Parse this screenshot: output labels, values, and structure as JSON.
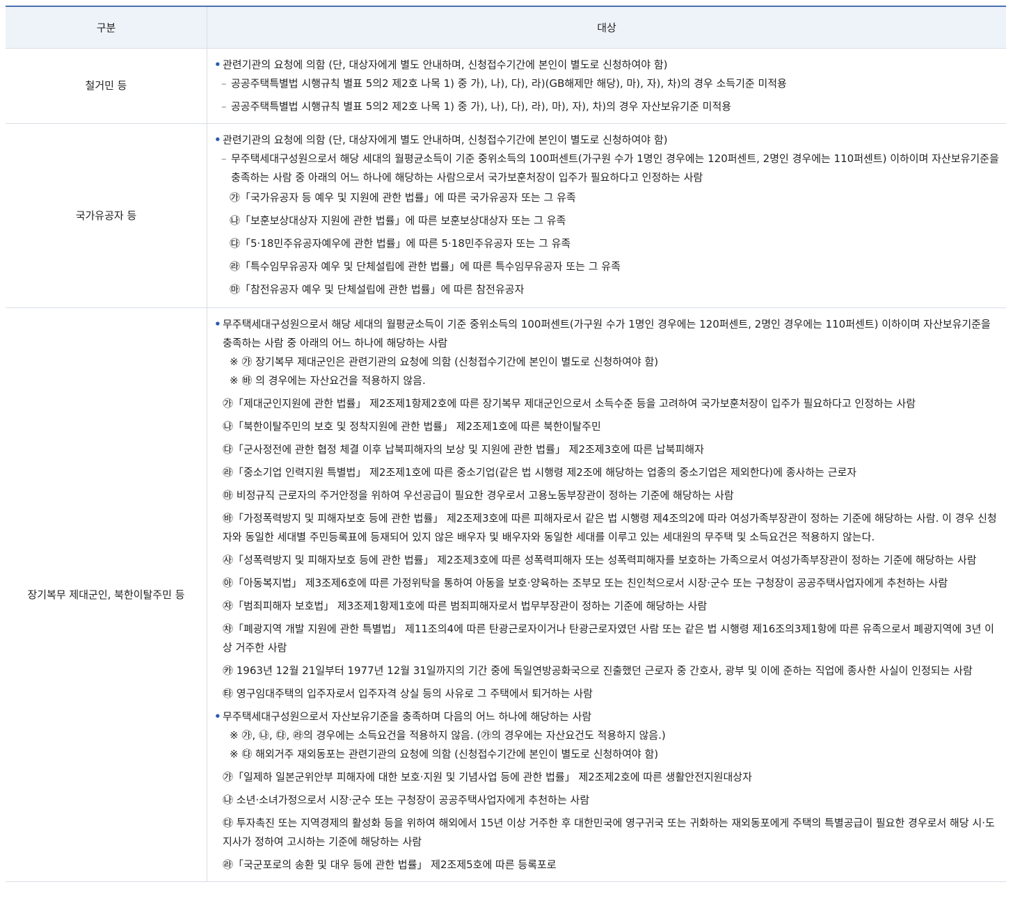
{
  "header": {
    "col1": "구분",
    "col2": "대상"
  },
  "rows": [
    {
      "category": "철거민 등",
      "bullet": "관련기관의 요청에 의함 (단, 대상자에게 별도 안내하며, 신청접수기간에 본인이 별도로 신청하여야 함)",
      "dashes": [
        "공공주택특별법 시행규칙 별표 5의2 제2호 나목 1) 중 가), 나), 다), 라)(GB해제만 해당), 마), 자), 차)의 경우 소득기준 미적용",
        "공공주택특별법 시행규칙 별표 5의2 제2호 나목 1) 중 가), 나), 다), 라), 마), 자), 차)의 경우 자산보유기준 미적용"
      ]
    },
    {
      "category": "국가유공자 등",
      "bullet": "관련기관의 요청에 의함 (단, 대상자에게 별도 안내하며, 신청접수기간에 본인이 별도로 신청하여야 함)",
      "dash": "무주택세대구성원으로서 해당 세대의 월평균소득이 기준 중위소득의 100퍼센트(가구원 수가 1명인 경우에는 120퍼센트, 2명인 경우에는 110퍼센트) 이하이며 자산보유기준을 충족하는 사람 중 아래의 어느 하나에 해당하는 사람으로서 국가보훈처장이 입주가 필요하다고 인정하는 사람",
      "items": [
        "㉮「국가유공자 등 예우 및 지원에 관한 법률」에 따른 국가유공자 또는 그 유족",
        "㉯「보훈보상대상자 지원에 관한 법률」에 따른 보훈보상대상자 또는 그 유족",
        "㉰「5·18민주유공자예우에 관한 법률」에 따른 5·18민주유공자 또는 그 유족",
        "㉱「특수임무유공자 예우 및 단체설립에 관한 법률」에 따른 특수임무유공자 또는 그 유족",
        "㉲「참전유공자 예우 및 단체설립에 관한 법률」에 따른 참전유공자"
      ]
    },
    {
      "category": "장기복무 제대군인, 북한이탈주민 등",
      "bullet1": "무주택세대구성원으로서 해당 세대의 월평균소득이 기준 중위소득의 100퍼센트(가구원 수가 1명인 경우에는 120퍼센트, 2명인 경우에는 110퍼센트) 이하이며 자산보유기준을 충족하는 사람 중 아래의 어느 하나에 해당하는 사람",
      "notes1": [
        "※ ㉮ 장기복무 제대군인은 관련기관의 요청에 의함 (신청접수기간에 본인이 별도로 신청하여야 함)",
        "※ ㉳ 의 경우에는 자산요건을 적용하지 않음."
      ],
      "items1": [
        "㉮「제대군인지원에 관한 법률」 제2조제1항제2호에 따른 장기복무 제대군인으로서 소득수준 등을 고려하여 국가보훈처장이 입주가 필요하다고 인정하는 사람",
        "㉯「북한이탈주민의 보호 및 정착지원에 관한 법률」 제2조제1호에 따른 북한이탈주민",
        "㉰「군사정전에 관한 협정 체결 이후 납북피해자의 보상 및 지원에 관한 법률」 제2조제3호에 따른 납북피해자",
        "㉱「중소기업 인력지원 특별법」 제2조제1호에 따른 중소기업(같은 법 시행령 제2조에 해당하는 업종의 중소기업은 제외한다)에 종사하는 근로자",
        "㉲ 비정규직 근로자의 주거안정을 위하여 우선공급이 필요한 경우로서 고용노동부장관이 정하는 기준에 해당하는 사람",
        "㉳「가정폭력방지 및 피해자보호 등에 관한 법률」 제2조제3호에 따른 피해자로서 같은 법 시행령 제4조의2에 따라 여성가족부장관이 정하는 기준에 해당하는 사람. 이 경우 신청자와 동일한 세대별 주민등록표에 등재되어 있지 않은 배우자 및 배우자와 동일한 세대를 이루고 있는 세대원의 무주택 및 소득요건은 적용하지 않는다.",
        "㉴「성폭력방지 및 피해자보호 등에 관한 법률」 제2조제3호에 따른 성폭력피해자 또는 성폭력피해자를 보호하는 가족으로서 여성가족부장관이 정하는 기준에 해당하는 사람",
        "㉵「아동복지법」 제3조제6호에 따른 가정위탁을 통하여 아동을 보호·양육하는 조부모 또는 친인척으로서 시장·군수 또는 구청장이 공공주택사업자에게 추천하는 사람",
        "㉶「범죄피해자 보호법」 제3조제1항제1호에 따른 범죄피해자로서 법무부장관이 정하는 기준에 해당하는 사람",
        "㉷「폐광지역 개발 지원에 관한 특별법」 제11조의4에 따른 탄광근로자이거나 탄광근로자였던 사람 또는 같은 법 시행령 제16조의3제1항에 따른 유족으로서 폐광지역에 3년 이상 거주한 사람",
        "㉸ 1963년 12월 21일부터 1977년 12월 31일까지의 기간 중에 독일연방공화국으로 진출했던 근로자 중 간호사, 광부 및 이에 준하는 직업에 종사한 사실이 인정되는 사람",
        "㉹ 영구임대주택의 입주자로서 입주자격 상실 등의 사유로 그 주택에서 퇴거하는 사람"
      ],
      "bullet2": "무주택세대구성원으로서 자산보유기준을 충족하며 다음의 어느 하나에 해당하는 사람",
      "notes2": [
        "※ ㉮, ㉯, ㉰, ㉱의 경우에는 소득요건을 적용하지 않음. (㉮의 경우에는 자산요건도 적용하지 않음.)",
        "※ ㉰ 해외거주 재외동포는 관련기관의 요청에 의함 (신청접수기간에 본인이 별도로 신청하여야 함)"
      ],
      "items2": [
        "㉮「일제하 일본군위안부 피해자에 대한 보호·지원 및 기념사업 등에 관한 법률」 제2조제2호에 따른 생활안전지원대상자",
        "㉯ 소년·소녀가정으로서 시장·군수 또는 구청장이 공공주택사업자에게 추천하는 사람",
        "㉰ 투자촉진 또는 지역경제의 활성화 등을 위하여 해외에서 15년 이상 거주한 후 대한민국에 영구귀국 또는 귀화하는 재외동포에게 주택의 특별공급이 필요한 경우로서 해당 시·도지사가 정하여 고시하는 기준에 해당하는 사람",
        "㉱「국군포로의 송환 및 대우 등에 관한 법률」 제2조제5호에 따른 등록포로"
      ]
    }
  ]
}
